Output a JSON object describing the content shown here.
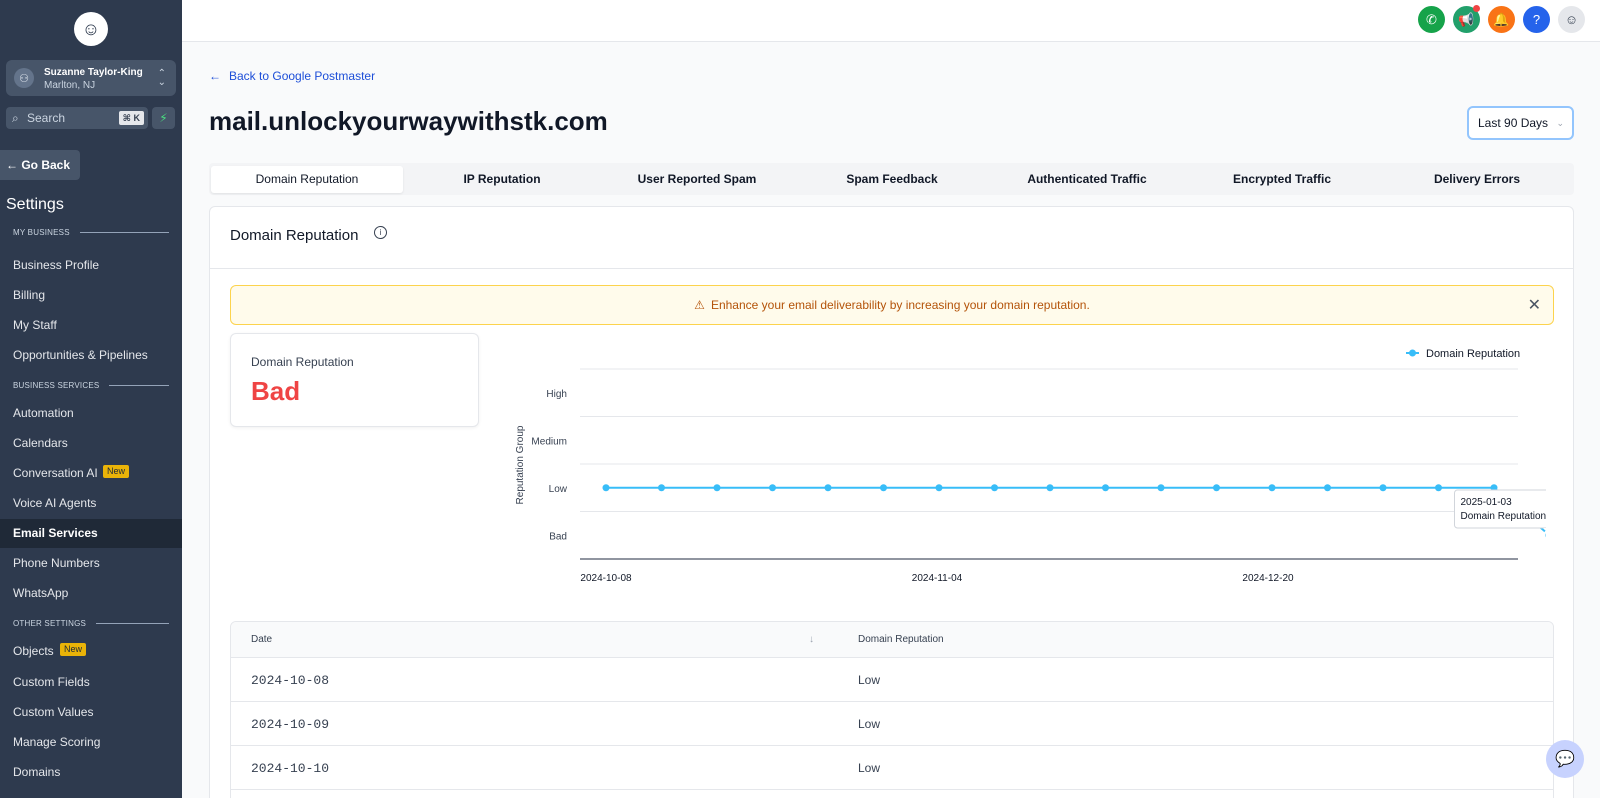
{
  "sidebar": {
    "account_name": "Suzanne Taylor-King",
    "account_location": "Marlton, NJ",
    "search_placeholder": "Search",
    "search_shortcut": "⌘ K",
    "go_back": "Go Back",
    "settings_title": "Settings",
    "sections": [
      {
        "label": "MY BUSINESS"
      },
      {
        "label": "BUSINESS SERVICES"
      },
      {
        "label": "OTHER SETTINGS"
      }
    ],
    "items": [
      {
        "label": "Business Profile"
      },
      {
        "label": "Billing"
      },
      {
        "label": "My Staff"
      },
      {
        "label": "Opportunities & Pipelines"
      },
      {
        "label": "Automation"
      },
      {
        "label": "Calendars"
      },
      {
        "label": "Conversation AI",
        "badge": "New"
      },
      {
        "label": "Voice AI Agents"
      },
      {
        "label": "Email Services",
        "active": true
      },
      {
        "label": "Phone Numbers"
      },
      {
        "label": "WhatsApp"
      },
      {
        "label": "Objects",
        "badge": "New"
      },
      {
        "label": "Custom Fields"
      },
      {
        "label": "Custom Values"
      },
      {
        "label": "Manage Scoring"
      },
      {
        "label": "Domains"
      }
    ]
  },
  "topbar": {
    "icons": [
      {
        "name": "phone-icon",
        "color": "#16a34a"
      },
      {
        "name": "megaphone-icon",
        "color": "#22a06b"
      },
      {
        "name": "bell-icon",
        "color": "#f97316"
      },
      {
        "name": "help-icon",
        "color": "#2563eb"
      },
      {
        "name": "avatar-icon",
        "color": "#e5e7eb"
      }
    ]
  },
  "main": {
    "back_link": "Back to Google Postmaster",
    "domain": "mail.unlockyourwaywithstk.com",
    "range": "Last 90 Days",
    "tabs": [
      {
        "label": "Domain Reputation",
        "active": true
      },
      {
        "label": "IP Reputation"
      },
      {
        "label": "User Reported Spam"
      },
      {
        "label": "Spam Feedback"
      },
      {
        "label": "Authenticated Traffic"
      },
      {
        "label": "Encrypted Traffic"
      },
      {
        "label": "Delivery Errors"
      }
    ],
    "card_title": "Domain Reputation",
    "alert": "Enhance your email deliverability by increasing your domain reputation.",
    "stat_label": "Domain Reputation",
    "stat_value": "Bad",
    "table": {
      "headers": [
        "Date",
        "Domain Reputation"
      ],
      "rows": [
        {
          "date": "2024-10-08",
          "rep": "Low"
        },
        {
          "date": "2024-10-09",
          "rep": "Low"
        },
        {
          "date": "2024-10-10",
          "rep": "Low"
        }
      ]
    }
  },
  "chart_data": {
    "type": "line",
    "ylabel": "Reputation Group",
    "y_categories": [
      "Bad",
      "Low",
      "Medium",
      "High"
    ],
    "x_tick_labels": [
      "2024-10-08",
      "2024-11-04",
      "2024-12-20"
    ],
    "legend_position": "top-right",
    "series": [
      {
        "name": "Domain Reputation",
        "color": "#38bdf8",
        "values": [
          "Low",
          "Low",
          "Low",
          "Low",
          "Low",
          "Low",
          "Low",
          "Low",
          "Low",
          "Low",
          "Low",
          "Low",
          "Low",
          "Low",
          "Low",
          "Low",
          "Low",
          "Bad"
        ]
      }
    ],
    "tooltip": {
      "date": "2025-01-03",
      "text": "Domain Reputation: Bad"
    }
  }
}
